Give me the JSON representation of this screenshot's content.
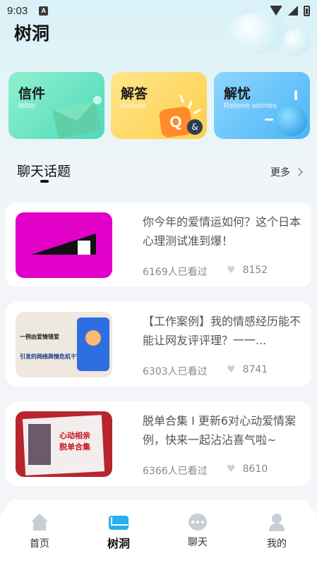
{
  "statusbar": {
    "time": "9:03",
    "notif_icon": "A"
  },
  "header": {
    "title": "树洞"
  },
  "categories": [
    {
      "title": "信件",
      "subtitle": "letter",
      "icon": "envelope-icon"
    },
    {
      "title": "解答",
      "subtitle": "Answer",
      "icon": "qa-icon",
      "badge_q": "Q",
      "badge_amp": "&"
    },
    {
      "title": "解忧",
      "subtitle": "Relieve worries",
      "icon": "globe-icon"
    }
  ],
  "section": {
    "title": "聊天话题",
    "more_label": "更多"
  },
  "topics": [
    {
      "title": "你今年的爱情运如何？这个日本心理测试准到爆！",
      "views": "6169人已看过",
      "likes": "8152"
    },
    {
      "title": "【工作案例】我的情感经历能不能让网友评评理？一一...",
      "views": "6303人已看过",
      "likes": "8741",
      "thumb_text1": "一例由爱情错爱",
      "thumb_text2": "引发的网络舆情危机干预"
    },
    {
      "title": "脱单合集 I 更新6对心动爱情案例，快来一起沾沾喜气啦~",
      "views": "6366人已看过",
      "likes": "8610",
      "thumb_text1": "心动相亲",
      "thumb_text2": "脱单合集"
    }
  ],
  "nav": [
    {
      "label": "首页",
      "icon": "home-icon",
      "active": false
    },
    {
      "label": "树洞",
      "icon": "mail-icon",
      "active": true
    },
    {
      "label": "聊天",
      "icon": "chat-icon",
      "active": false
    },
    {
      "label": "我的",
      "icon": "user-icon",
      "active": false
    }
  ],
  "colors": {
    "accent": "#26b1f0",
    "card_letter": "#4ed9b8",
    "card_answer": "#ffcf4d",
    "card_relieve": "#4ab6f5"
  }
}
